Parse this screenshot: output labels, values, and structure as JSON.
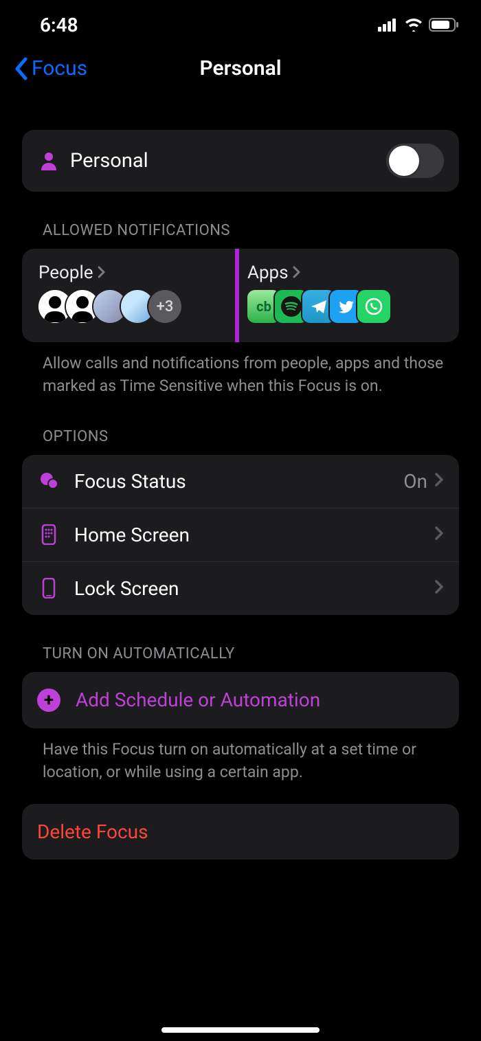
{
  "status": {
    "time": "6:48"
  },
  "nav": {
    "back": "Focus",
    "title": "Personal"
  },
  "focus": {
    "name": "Personal",
    "enabled": false
  },
  "allowed": {
    "header": "ALLOWED NOTIFICATIONS",
    "people": {
      "label": "People",
      "more": "+3"
    },
    "apps": {
      "label": "Apps"
    },
    "footer": "Allow calls and notifications from people, apps and those marked as Time Sensitive when this Focus is on."
  },
  "options": {
    "header": "OPTIONS",
    "rows": [
      {
        "label": "Focus Status",
        "value": "On"
      },
      {
        "label": "Home Screen",
        "value": ""
      },
      {
        "label": "Lock Screen",
        "value": ""
      }
    ]
  },
  "auto": {
    "header": "TURN ON AUTOMATICALLY",
    "add": "Add Schedule or Automation",
    "footer": "Have this Focus turn on automatically at a set time or location, or while using a certain app."
  },
  "delete": {
    "label": "Delete Focus"
  }
}
